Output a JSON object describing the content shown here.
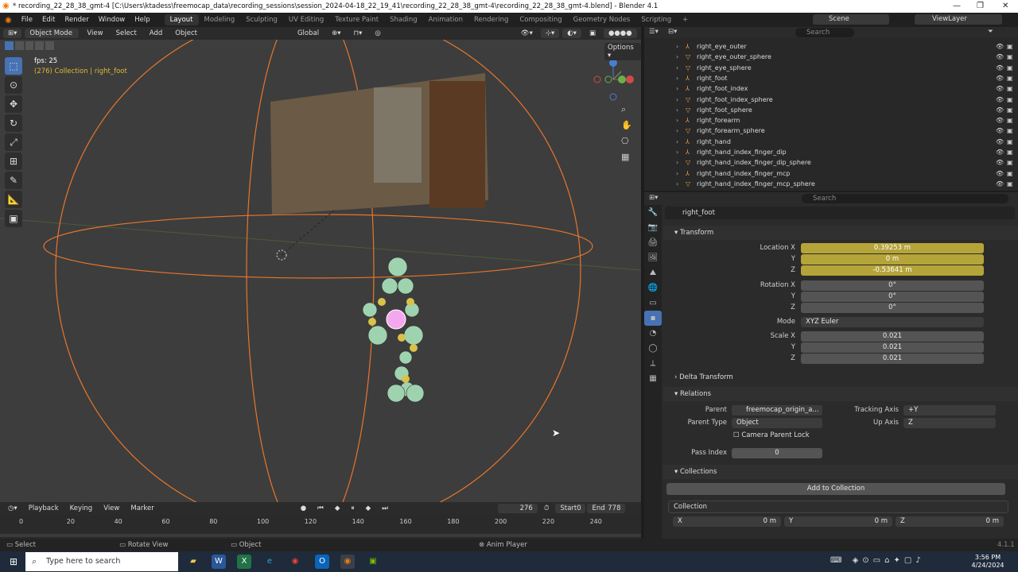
{
  "window": {
    "title": "* recording_22_28_38_gmt-4 [C:\\Users\\ktadess\\freemocap_data\\recording_sessions\\session_2024-04-18_22_19_41\\recording_22_28_38_gmt-4\\recording_22_28_38_gmt-4.blend] - Blender 4.1"
  },
  "menubar": {
    "items": [
      "File",
      "Edit",
      "Render",
      "Window",
      "Help"
    ],
    "workspaces": [
      "Layout",
      "Modeling",
      "Sculpting",
      "UV Editing",
      "Texture Paint",
      "Shading",
      "Animation",
      "Rendering",
      "Compositing",
      "Geometry Nodes",
      "Scripting"
    ],
    "active_workspace": "Layout",
    "scene_label": "Scene",
    "view_layer_label": "ViewLayer"
  },
  "viewport_header": {
    "mode": "Object Mode",
    "menus": [
      "View",
      "Select",
      "Add",
      "Object"
    ],
    "orientation": "Global",
    "options_label": "Options"
  },
  "viewport": {
    "fps_text": "fps: 25",
    "info_text": "(276) Collection | right_foot"
  },
  "outliner": {
    "search_placeholder": "Search",
    "rows": [
      {
        "name": "right_eye_outer",
        "icon": "empty-icon"
      },
      {
        "name": "right_eye_outer_sphere",
        "icon": "mesh-icon"
      },
      {
        "name": "right_eye_sphere",
        "icon": "mesh-icon"
      },
      {
        "name": "right_foot",
        "icon": "empty-icon"
      },
      {
        "name": "right_foot_index",
        "icon": "empty-icon"
      },
      {
        "name": "right_foot_index_sphere",
        "icon": "mesh-icon"
      },
      {
        "name": "right_foot_sphere",
        "icon": "mesh-icon"
      },
      {
        "name": "right_forearm",
        "icon": "empty-icon"
      },
      {
        "name": "right_forearm_sphere",
        "icon": "mesh-icon"
      },
      {
        "name": "right_hand",
        "icon": "empty-icon"
      },
      {
        "name": "right_hand_index_finger_dip",
        "icon": "empty-icon"
      },
      {
        "name": "right_hand_index_finger_dip_sphere",
        "icon": "mesh-icon"
      },
      {
        "name": "right_hand_index_finger_mcp",
        "icon": "empty-icon"
      },
      {
        "name": "right_hand_index_finger_mcp_sphere",
        "icon": "mesh-icon"
      }
    ]
  },
  "properties": {
    "search_placeholder": "Search",
    "object_name": "right_foot",
    "transform": {
      "header": "Transform",
      "location_label": "Location X",
      "y_label": "Y",
      "z_label": "Z",
      "location": [
        "0.39253 m",
        "0 m",
        "-0.53641 m"
      ],
      "rotation_label": "Rotation X",
      "rotation": [
        "0°",
        "0°",
        "0°"
      ],
      "mode_label": "Mode",
      "mode_value": "XYZ Euler",
      "scale_label": "Scale X",
      "scale": [
        "0.021",
        "0.021",
        "0.021"
      ]
    },
    "delta_transform": "Delta Transform",
    "relations": {
      "header": "Relations",
      "parent_label": "Parent",
      "parent_value": "freemocap_origin_a...",
      "tracking_axis_label": "Tracking Axis",
      "tracking_axis_value": "+Y",
      "parent_type_label": "Parent Type",
      "parent_type_value": "Object",
      "up_axis_label": "Up Axis",
      "up_axis_value": "Z",
      "camera_parent_lock": "Camera Parent Lock",
      "pass_index_label": "Pass Index",
      "pass_index_value": "0"
    },
    "collections": {
      "header": "Collections",
      "add_button": "Add to Collection",
      "collection_name": "Collection",
      "x_label": "X",
      "x_value": "0 m",
      "y_label": "Y",
      "y_value": "0 m",
      "z_label": "Z",
      "z_value": "0 m"
    }
  },
  "timeline": {
    "menus": [
      "Playback",
      "Keying",
      "View",
      "Marker"
    ],
    "current_frame": "276",
    "start_label": "Start",
    "start": "0",
    "end_label": "End",
    "end": "778",
    "ticks": [
      "0",
      "20",
      "40",
      "60",
      "80",
      "100",
      "120",
      "140",
      "160",
      "180",
      "200",
      "220",
      "240"
    ]
  },
  "statusbar": {
    "select": "Select",
    "rotate": "Rotate View",
    "object": "Object",
    "anim": "Anim Player",
    "version": "4.1.1"
  },
  "taskbar": {
    "search_placeholder": "Type here to search",
    "time": "3:56 PM",
    "date": "4/24/2024"
  },
  "colors": {
    "accent": "#4772b3",
    "animated_field": "#b5a439",
    "selection_orange": "#e8752a"
  }
}
